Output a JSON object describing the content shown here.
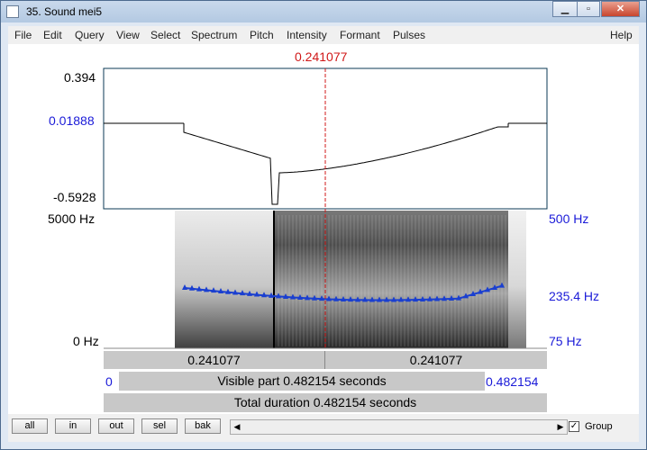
{
  "window": {
    "title": "35. Sound mei5"
  },
  "menu": [
    "File",
    "Edit",
    "Query",
    "View",
    "Select",
    "Spectrum",
    "Pitch",
    "Intensity",
    "Formant",
    "Pulses"
  ],
  "menu_help": "Help",
  "cursor_time": "0.241077",
  "waveform": {
    "max": "0.394",
    "center": "0.01888",
    "min": "-0.5928"
  },
  "spectrogram": {
    "top": "5000 Hz",
    "bottom": "0 Hz"
  },
  "pitch": {
    "top": "500 Hz",
    "mid": "235.4 Hz",
    "bottom": "75 Hz"
  },
  "selection": {
    "left": "0.241077",
    "right": "0.241077"
  },
  "visible": {
    "start": "0",
    "label": "Visible part 0.482154 seconds",
    "end": "0.482154"
  },
  "total": "Total duration 0.482154 seconds",
  "buttons": {
    "all": "all",
    "in": "in",
    "out": "out",
    "sel": "sel",
    "bak": "bak"
  },
  "group_label": "Group",
  "group_checked": true,
  "colors": {
    "cursor": "#d01818",
    "pitch": "#1a3fd0",
    "axis_blue": "#1a1ad8"
  },
  "icons": {
    "minimize": "minimize-icon",
    "maximize": "maximize-icon",
    "close": "close-icon"
  }
}
